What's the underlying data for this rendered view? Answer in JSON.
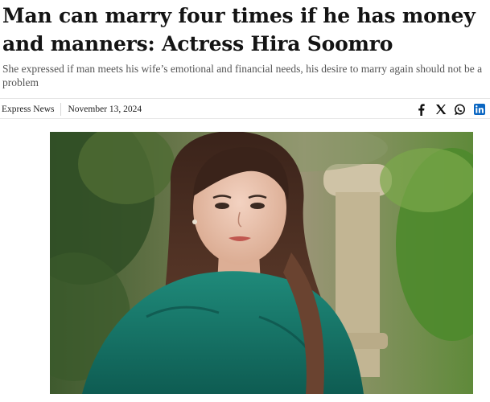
{
  "article": {
    "headline": "Man can marry four times if he has money and manners: Actress Hira Soomro",
    "subheadline": "She expressed if man meets his wife’s emotional and financial needs, his desire to marry again should not be a problem",
    "source": "Express News",
    "date": "November 13, 2024"
  },
  "share": {
    "icons": [
      "facebook-icon",
      "x-icon",
      "whatsapp-icon",
      "linkedin-icon"
    ]
  },
  "colors": {
    "linkedin": "#0a66c2",
    "text": "#141414",
    "muted": "#555555"
  }
}
